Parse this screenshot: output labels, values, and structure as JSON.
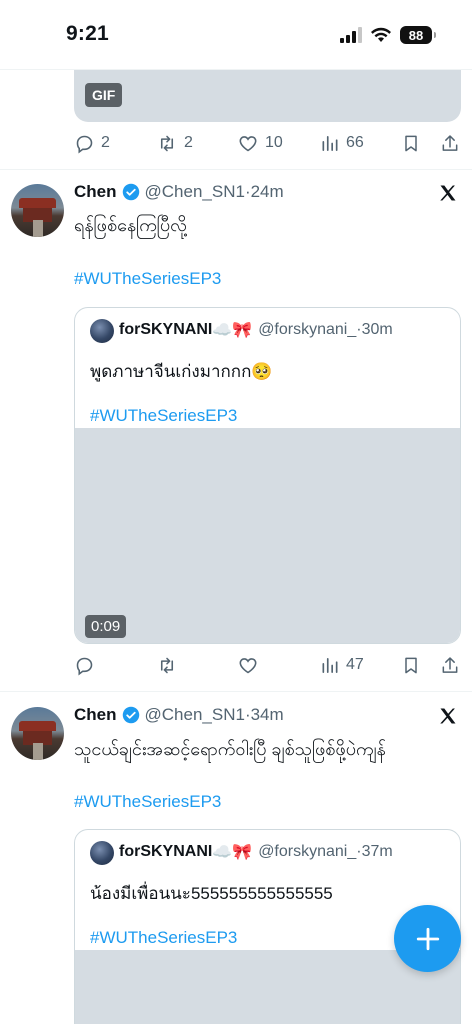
{
  "status_bar": {
    "time": "9:21",
    "battery": "88"
  },
  "prev_tweet": {
    "media_badge": "GIF",
    "actions": {
      "replies": "2",
      "reposts": "2",
      "likes": "10",
      "views": "66"
    }
  },
  "tweets": [
    {
      "name": "Chen",
      "handle": "@Chen_SN1",
      "time": "·24m",
      "text": "ရန်ဖြစ်နေကြပြီလို့",
      "hashtag": "#WUTheSeriesEP3",
      "quote": {
        "name": "forSKYNANI",
        "emoji": "☁️🎀",
        "handle": "@forskynani_",
        "time": "·30m",
        "text": "พูดภาษาจีนเก่งมากกก🥺",
        "hashtag": "#WUTheSeriesEP3",
        "video_duration": "0:09"
      },
      "actions": {
        "replies": "",
        "reposts": "",
        "likes": "",
        "views": "47"
      }
    },
    {
      "name": "Chen",
      "handle": "@Chen_SN1",
      "time": "·34m",
      "text": "သူငယ်ချင်းအဆင့်ရောက်ဝါးပြီ ချစ်သူဖြစ်ဖို့ပဲကျန်",
      "hashtag": "#WUTheSeriesEP3",
      "quote": {
        "name": "forSKYNANI",
        "emoji": "☁️🎀",
        "handle": "@forskynani_",
        "time": "·37m",
        "text": "น้องมีเพื่อนนะ555555555555555",
        "hashtag": "#WUTheSeriesEP3"
      }
    }
  ],
  "fab": {
    "icon": "plus-icon"
  },
  "colors": {
    "accent": "#1d9bf0",
    "muted": "#536471",
    "media": "#d5dce2"
  }
}
